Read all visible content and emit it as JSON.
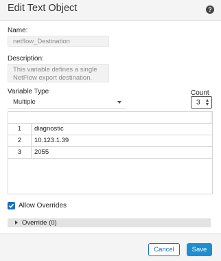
{
  "dialog": {
    "title": "Edit Text Object",
    "help_icon": "question-circle-icon",
    "help_glyph": "?"
  },
  "name": {
    "label": "Name:",
    "value": "netflow_Destination"
  },
  "description": {
    "label": "Description:",
    "lines": [
      "This variable defines a single",
      "NetFlow export destination."
    ]
  },
  "variable_type": {
    "label": "Variable Type",
    "selected": "Multiple"
  },
  "count": {
    "label": "Count",
    "value": "3"
  },
  "rows": [
    {
      "index": "1",
      "value": "diagnostic"
    },
    {
      "index": "2",
      "value": "10.123.1.39"
    },
    {
      "index": "3",
      "value": "2055"
    }
  ],
  "allow_overrides": {
    "label": "Allow Overrides",
    "checked": true
  },
  "override": {
    "label": "Override (0)"
  },
  "footer": {
    "cancel_label": "Cancel",
    "save_label": "Save"
  },
  "colors": {
    "accent": "#1d6fb8",
    "save_button": "#1d8fd0",
    "header_bg": "#f4f4f4"
  }
}
